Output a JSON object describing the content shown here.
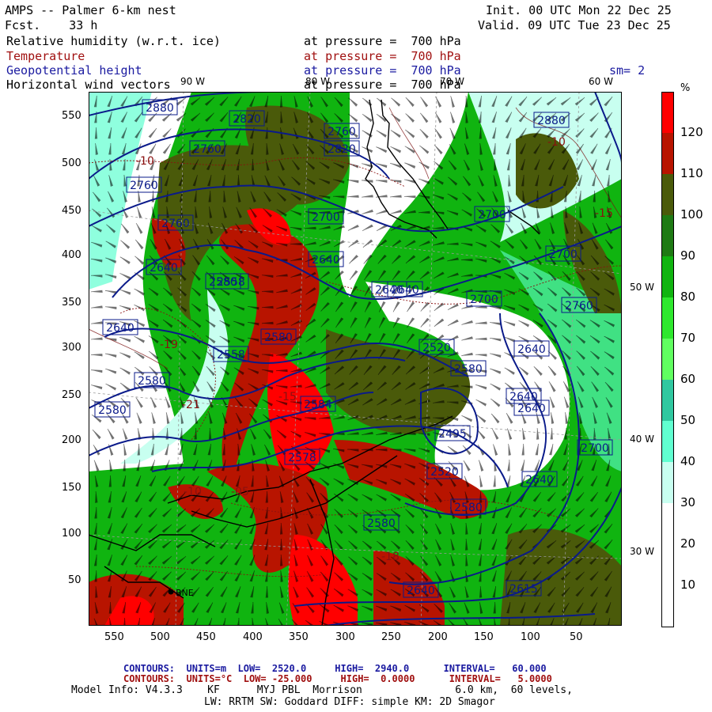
{
  "header": {
    "title": "AMPS -- Palmer 6-km nest",
    "fcst": "Fcst.    33 h",
    "init": "Init. 00 UTC Mon 22 Dec 25",
    "valid": "Valid. 09 UTC Tue 23 Dec 25",
    "fields": [
      {
        "name": "Relative humidity (w.r.t. ice)",
        "level": "at pressure =  700 hPa",
        "color": "#000000"
      },
      {
        "name": "Temperature",
        "level": "at pressure =  700 hPa",
        "color": "#a01010"
      },
      {
        "name": "Geopotential height",
        "level": "at pressure =  700 hPa",
        "color": "#1a1aa0"
      },
      {
        "name": "Horizontal wind vectors",
        "level": "at pressure =  700 hPa",
        "color": "#000000"
      }
    ],
    "sm": "sm= 2"
  },
  "axes": {
    "y_ticks": [
      "550",
      "500",
      "450",
      "400",
      "350",
      "300",
      "250",
      "200",
      "150",
      "100",
      "50"
    ],
    "x_ticks": [
      "550",
      "500",
      "450",
      "400",
      "350",
      "300",
      "250",
      "200",
      "150",
      "100",
      "50"
    ],
    "lon_top": [
      "90 W",
      "80 W",
      "70 W",
      "60 W"
    ],
    "lon_right": [
      "50 W",
      "40 W",
      "30 W"
    ]
  },
  "colorbar": {
    "unit": "%",
    "labels": [
      "120",
      "110",
      "100",
      "90",
      "80",
      "70",
      "60",
      "50",
      "40",
      "30",
      "20",
      "10"
    ],
    "colors": [
      "#ff0000",
      "#b81400",
      "#4a5a0a",
      "#1e7a14",
      "#10b410",
      "#2ee82e",
      "#60ff60",
      "#30c8a0",
      "#60ffd0",
      "#c8fff0",
      "#ffffff",
      "#ffffff",
      "#ffffff"
    ]
  },
  "height_labels": [
    "2880",
    "2820",
    "2760",
    "2760",
    "2760",
    "2700",
    "2700",
    "2640",
    "2640",
    "2640",
    "2640",
    "2580",
    "2580",
    "2580",
    "2580",
    "2520",
    "2558",
    "2558",
    "2584",
    "2578",
    "2640",
    "2700",
    "2760",
    "2700",
    "2760",
    "2820",
    "2880",
    "2640",
    "2640",
    "2580",
    "2580",
    "2520",
    "2580",
    "2640",
    "2615",
    "2640",
    "2700",
    "2640",
    "2495"
  ],
  "temp_labels": [
    "-10",
    "-15",
    "-19",
    "-21",
    "-10",
    "-15",
    "-18",
    "-10",
    "-05"
  ],
  "footer": {
    "contours1": "CONTOURS:  UNITS=m  LOW=  2520.0     HIGH=  2940.0      INTERVAL=   60.000",
    "contours2": "CONTOURS:  UNITS=°C  LOW= -25.000     HIGH=  0.0000      INTERVAL=   5.0000",
    "model1": "Model Info: V4.3.3    KF      MYJ PBL  Morrison               6.0 km,  60 levels,",
    "model2": "LW: RRTM SW: Goddard DIFF: simple KM: 2D Smagor"
  },
  "station": "BNE"
}
